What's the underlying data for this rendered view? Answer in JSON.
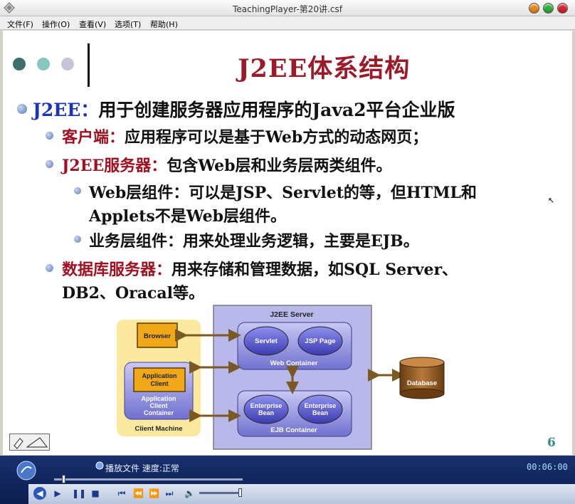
{
  "window": {
    "title": "TeachingPlayer-第20讲.csf"
  },
  "menu": {
    "items": [
      "文件(F)",
      "操作(O)",
      "查看(V)",
      "选项(T)",
      "帮助(H)"
    ]
  },
  "slide": {
    "title": "J2EE体系结构",
    "dot_colors": [
      "#3d6f6b",
      "#86c8c0",
      "#c8c4d8"
    ],
    "lines": [
      {
        "label": "J2EE：",
        "text": "用于创建服务器应用程序的Java2平台企业版"
      },
      {
        "label": "客户端：",
        "text": "应用程序可以是基于Web方式的动态网页；"
      },
      {
        "label": "J2EE服务器：",
        "text": "包含Web层和业务层两类组件。"
      },
      {
        "label": "",
        "text": "Web层组件：可以是JSP、Servlet的等，但HTML和"
      },
      {
        "label": "",
        "text": "Applets不是Web层组件。"
      },
      {
        "label": "",
        "text": "业务层组件：用来处理业务逻辑，主要是EJB。"
      },
      {
        "label": "数据库服务器：",
        "text": "用来存储和管理数据，如SQL Server、"
      },
      {
        "label": "",
        "text": "DB2、Oracal等。"
      }
    ],
    "diagram": {
      "server_title": "J2EE Server",
      "browser": "Browser",
      "app_client_line1": "Application",
      "app_client_line2": "Client",
      "app_client_container_1": "Application",
      "app_client_container_2": "Client",
      "app_client_container_3": "Container",
      "client_machine": "Client Machine",
      "servlet": "Servlet",
      "jsp_page": "JSP Page",
      "web_container": "Web Container",
      "enterprise_bean_1a": "Enterprise",
      "enterprise_bean_1b": "Bean",
      "enterprise_bean_2a": "Enterprise",
      "enterprise_bean_2b": "Bean",
      "ejb_container": "EJB Container",
      "database": "Database"
    },
    "page_number": "6"
  },
  "player": {
    "status": "播放文件 速度:正常",
    "time": "00:06:00",
    "progress_fraction": 0.05,
    "volume_fraction": 0.95
  }
}
